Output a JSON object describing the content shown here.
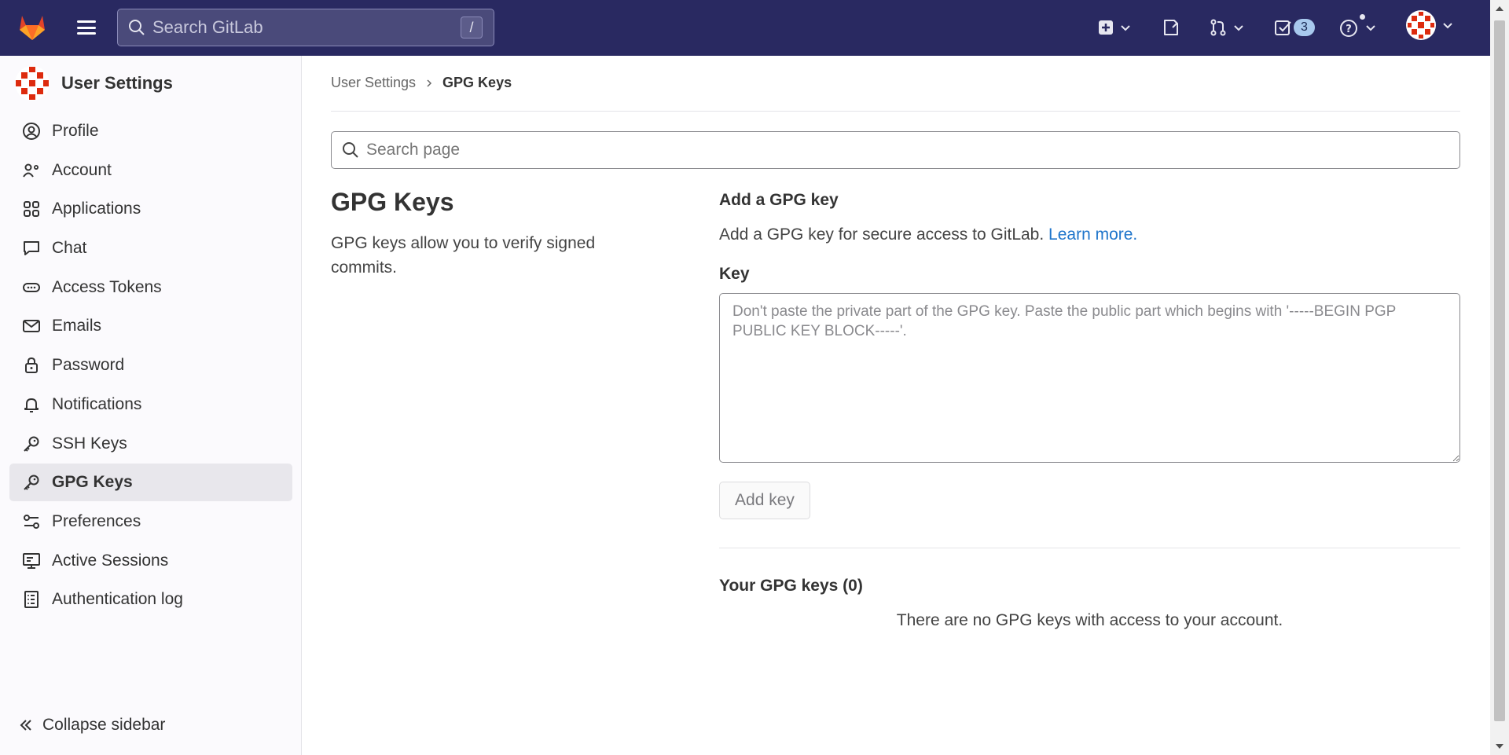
{
  "topbar": {
    "search_placeholder": "Search GitLab",
    "search_shortcut": "/",
    "todo_count": "3"
  },
  "sidebar": {
    "title": "User Settings",
    "items": [
      {
        "label": "Profile",
        "icon": "profile-icon"
      },
      {
        "label": "Account",
        "icon": "account-icon"
      },
      {
        "label": "Applications",
        "icon": "applications-icon"
      },
      {
        "label": "Chat",
        "icon": "chat-icon"
      },
      {
        "label": "Access Tokens",
        "icon": "token-icon"
      },
      {
        "label": "Emails",
        "icon": "mail-icon"
      },
      {
        "label": "Password",
        "icon": "lock-icon"
      },
      {
        "label": "Notifications",
        "icon": "bell-icon"
      },
      {
        "label": "SSH Keys",
        "icon": "key-icon"
      },
      {
        "label": "GPG Keys",
        "icon": "key-icon"
      },
      {
        "label": "Preferences",
        "icon": "preferences-icon"
      },
      {
        "label": "Active Sessions",
        "icon": "monitor-icon"
      },
      {
        "label": "Authentication log",
        "icon": "log-icon"
      }
    ],
    "active_index": 9,
    "collapse_label": "Collapse sidebar"
  },
  "breadcrumb": {
    "parent": "User Settings",
    "current": "GPG Keys"
  },
  "main": {
    "search_placeholder": "Search page",
    "title": "GPG Keys",
    "description": "GPG keys allow you to verify signed commits.",
    "add_heading": "Add a GPG key",
    "add_desc": "Add a GPG key for secure access to GitLab.",
    "learn_more": "Learn more.",
    "key_label": "Key",
    "key_placeholder": "Don't paste the private part of the GPG key. Paste the public part which begins with '-----BEGIN PGP PUBLIC KEY BLOCK-----'.",
    "add_button": "Add key",
    "your_keys_heading": "Your GPG keys (0)",
    "empty_text": "There are no GPG keys with access to your account."
  },
  "colors": {
    "topbar": "#292961",
    "link": "#1f75cb",
    "logo_orange": "#e24329",
    "avatar_red": "#dd2b0e"
  }
}
